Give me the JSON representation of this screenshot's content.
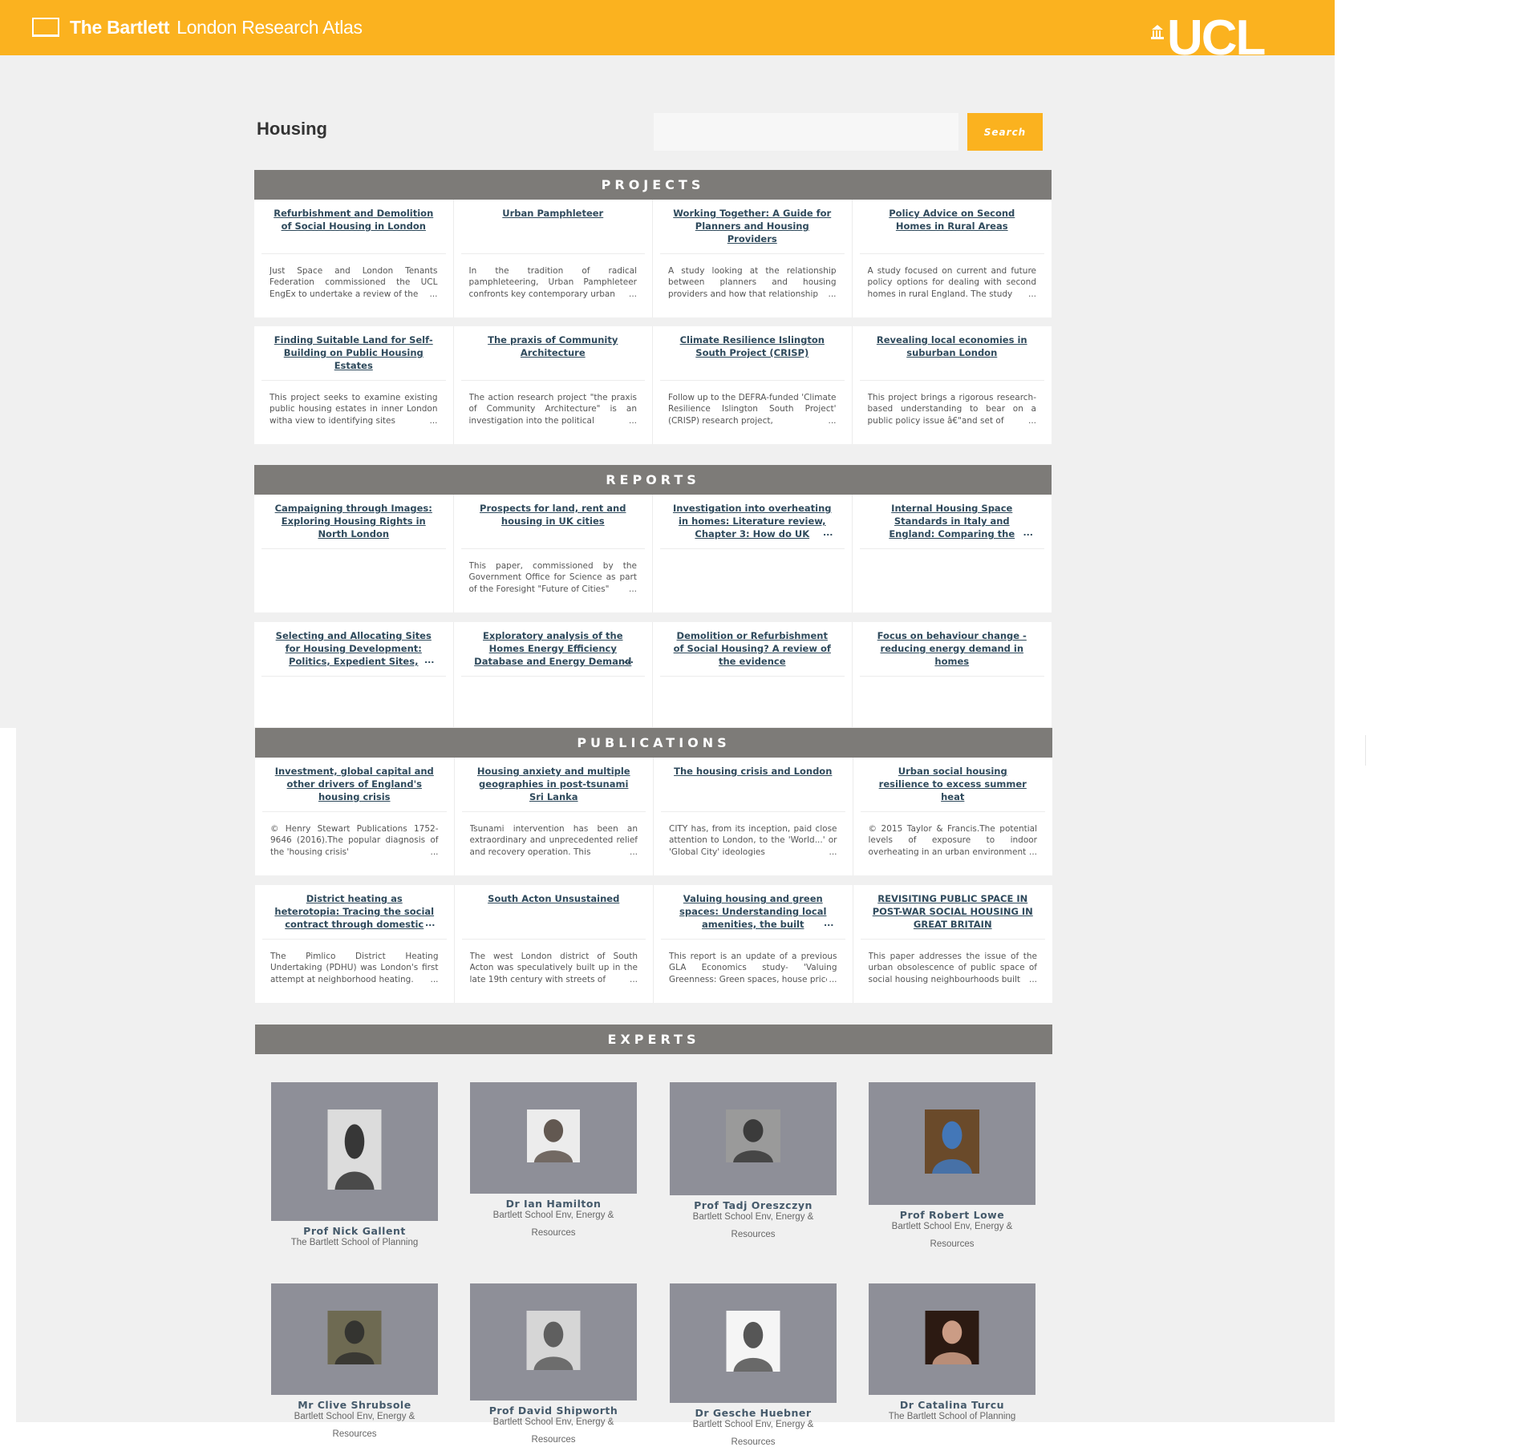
{
  "header": {
    "brand_bold": "The Bartlett",
    "brand_light": "London Research Atlas",
    "university_logo_text": "UCL"
  },
  "search": {
    "page_title": "Housing",
    "input_value": "",
    "button_label": "Search"
  },
  "projects": {
    "heading": "PROJECTS",
    "rows": [
      [
        {
          "title": "Refurbishment and Demolition of Social Housing in London",
          "desc": "Just Space and London Tenants Federation commissioned the UCL EngEx to undertake a review of the"
        },
        {
          "title": "Urban Pamphleteer",
          "desc": "In the tradition of radical pamphleteering, Urban Pamphleteer confronts key contemporary urban"
        },
        {
          "title": "Working Together: A Guide for Planners and Housing Providers",
          "desc": "A study looking at the relationship between planners and housing providers and how that relationship"
        },
        {
          "title": "Policy Advice on Second Homes in Rural Areas",
          "desc": "A study focused on current and future policy options for dealing with second homes in rural England. The study"
        }
      ],
      [
        {
          "title": "Finding Suitable Land for Self-Building on Public Housing Estates",
          "desc": "This project seeks to examine existing public housing estates in inner London witha view to identifying sites"
        },
        {
          "title": "The praxis of Community Architecture",
          "desc": "The action research project \"the praxis of Community Architecture\" is an investigation into the political"
        },
        {
          "title": "Climate Resilience Islington South Project (CRISP)",
          "desc": "Follow up to the DEFRA-funded 'Climate Resilience Islington South Project' (CRISP) research project,"
        },
        {
          "title": "Revealing local economies in suburban London",
          "desc": "This project brings a rigorous research-based understanding to bear on a public policy issue â€\"and set of"
        }
      ]
    ]
  },
  "reports": {
    "heading": "REPORTS",
    "rows": [
      [
        {
          "title": "Campaigning through Images: Exploring Housing Rights in North London",
          "desc": ""
        },
        {
          "title": "Prospects for land, rent and housing in UK cities",
          "desc": "This paper, commissioned by the Government Office for Science as part of the Foresight \"Future of Cities\""
        },
        {
          "title": "Investigation into overheating in homes: Literature review, Chapter 3: How do UK dwellings",
          "desc": ""
        },
        {
          "title": "Internal Housing Space Standards in Italy and England: Comparing the Conditions of",
          "desc": ""
        }
      ],
      [
        {
          "title": "Selecting and Allocating Sites for Housing Development: Politics, Expedient Sites,",
          "desc": ""
        },
        {
          "title": "Exploratory analysis of the Homes Energy Efficiency Database and Energy Demand",
          "desc": ""
        },
        {
          "title": "Demolition or Refurbishment of Social Housing? A review of the evidence",
          "desc": ""
        },
        {
          "title": "Focus on behaviour change - reducing energy demand in homes",
          "desc": ""
        }
      ]
    ]
  },
  "publications": {
    "heading": "PUBLICATIONS",
    "rows": [
      [
        {
          "title": "Investment, global capital and other drivers of England's housing crisis",
          "desc": "© Henry Stewart Publications 1752-9646 (2016).The popular diagnosis of the 'housing crisis'"
        },
        {
          "title": "Housing anxiety and multiple geographies in post-tsunami Sri Lanka",
          "desc": "Tsunami intervention has been an extraordinary and unprecedented relief and recovery operation. This"
        },
        {
          "title": "The housing crisis and London",
          "desc": "CITY has, from its inception, paid close attention to London, to the 'World...' or 'Global City' ideologies"
        },
        {
          "title": "Urban social housing resilience to excess summer heat",
          "desc": "© 2015 Taylor & Francis.The potential levels of exposure to indoor overheating in an urban environment"
        }
      ],
      [
        {
          "title": "District heating as heterotopia: Tracing the social contract through domestic energy",
          "desc": "The Pimlico District Heating Undertaking (PDHU) was London's first attempt at neighborhood heating."
        },
        {
          "title": "South Acton Unsustained",
          "desc": "The west London district of South Acton was speculatively built up in the late 19th century with streets of"
        },
        {
          "title": "Valuing housing and green spaces: Understanding local amenities, the built environment",
          "desc": "This report is an update of a previous GLA Economics study- 'Valuing Greenness: Green spaces, house prices"
        },
        {
          "title": "REVISITING PUBLIC SPACE IN POST-WAR SOCIAL HOUSING IN GREAT BRITAIN",
          "desc": "This paper addresses the issue of the urban obsolescence of public space of social housing neighbourhoods built"
        }
      ]
    ]
  },
  "experts": {
    "heading": "EXPERTS",
    "people": [
      {
        "name": "Prof Nick Gallent",
        "dept": "The Bartlett School of Planning",
        "photo_colors": [
          "#dcdcdc",
          "#1a1a1a"
        ]
      },
      {
        "name": "Dr Ian Hamilton",
        "dept": "Bartlett School Env, Energy & Resources",
        "photo_colors": [
          "#ececec",
          "#4a3e36"
        ]
      },
      {
        "name": "Prof Tadj Oreszczyn",
        "dept": "Bartlett School Env, Energy & Resources",
        "photo_colors": [
          "#9a9a9a",
          "#2a2a2a"
        ]
      },
      {
        "name": "Prof Robert Lowe",
        "dept": "Bartlett School Env, Energy & Resources",
        "photo_colors": [
          "#6a4a2a",
          "#3c7fd1"
        ]
      },
      {
        "name": "Mr Clive Shrubsole",
        "dept": "Bartlett School Env, Energy & Resources",
        "photo_colors": [
          "#6e6a52",
          "#2a2a2a"
        ]
      },
      {
        "name": "Prof David Shipworth",
        "dept": "Bartlett School Env, Energy & Resources",
        "photo_colors": [
          "#d6d6d6",
          "#4a4a4a"
        ]
      },
      {
        "name": "Dr Gesche Huebner",
        "dept": "Bartlett School Env, Energy & Resources",
        "photo_colors": [
          "#f5f5f5",
          "#3a3a3a"
        ]
      },
      {
        "name": "Dr Catalina Turcu",
        "dept": "The Bartlett School of Planning",
        "photo_colors": [
          "#2c1a12",
          "#e8b49a"
        ]
      }
    ]
  },
  "colors": {
    "brand_yellow": "#fbb21f",
    "section_grey": "#7d7b78",
    "link_blue": "#2f4a5c",
    "expert_tile": "#8e8f98"
  }
}
